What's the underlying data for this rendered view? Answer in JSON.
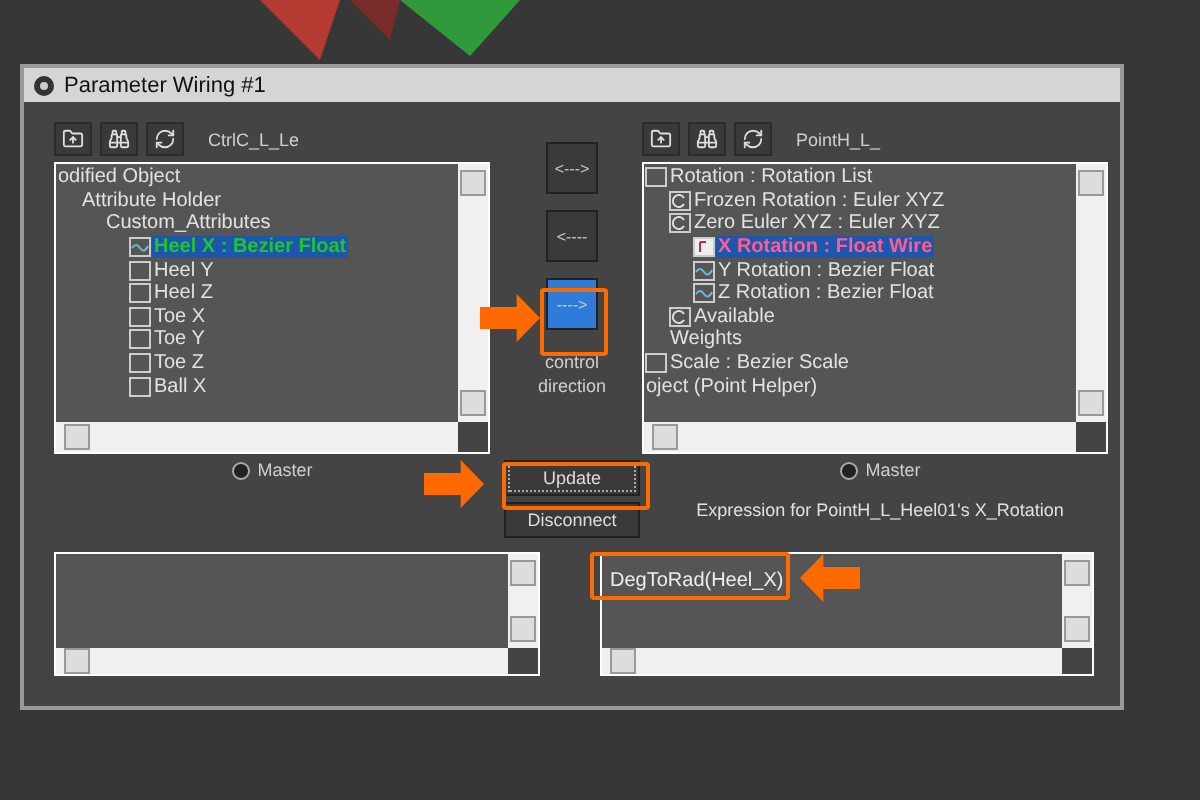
{
  "window": {
    "title": "Parameter Wiring #1"
  },
  "left_panel": {
    "object_name": "CtrlC_L_Le",
    "master": {
      "label": "Master",
      "selected": false
    },
    "tree": [
      {
        "label": "odified Object",
        "children": [
          {
            "label": "Attribute Holder",
            "children": [
              {
                "label": "Custom_Attributes",
                "children": [
                  {
                    "label": "Heel X : Bezier Float",
                    "kind": "curve",
                    "selected": true
                  },
                  {
                    "label": "Heel Y",
                    "kind": "box",
                    "selected": false
                  },
                  {
                    "label": "Heel Z",
                    "kind": "box",
                    "selected": false
                  },
                  {
                    "label": "Toe X",
                    "kind": "box",
                    "selected": false
                  },
                  {
                    "label": "Toe Y",
                    "kind": "box",
                    "selected": false
                  },
                  {
                    "label": "Toe Z",
                    "kind": "box",
                    "selected": false
                  },
                  {
                    "label": "Ball X",
                    "kind": "box",
                    "selected": false
                  }
                ]
              }
            ]
          }
        ]
      }
    ]
  },
  "right_panel": {
    "object_name": "PointH_L_",
    "master": {
      "label": "Master",
      "selected": false
    },
    "tree": [
      {
        "label": "Rotation : Rotation List",
        "kind": "box",
        "children": [
          {
            "label": "Frozen Rotation : Euler XYZ",
            "kind": "rotation"
          },
          {
            "label": "Zero Euler XYZ : Euler XYZ",
            "kind": "rotation",
            "children": [
              {
                "label": "X Rotation : Float Wire",
                "kind": "wire",
                "selected": true
              },
              {
                "label": "Y Rotation : Bezier Float",
                "kind": "curve",
                "selected": false
              },
              {
                "label": "Z Rotation : Bezier Float",
                "kind": "curve",
                "selected": false
              }
            ]
          },
          {
            "label": "Available",
            "kind": "rotation"
          },
          {
            "label": "Weights"
          }
        ]
      },
      {
        "label": "Scale : Bezier Scale",
        "kind": "box"
      },
      {
        "label": "oject (Point Helper)"
      }
    ]
  },
  "direction_buttons": [
    {
      "label": "<--->",
      "selected": false
    },
    {
      "label": "<----",
      "selected": false
    },
    {
      "label": "---->",
      "selected": true
    }
  ],
  "direction_caption": "control direction",
  "buttons": [
    {
      "label": "Update",
      "focused": true
    },
    {
      "label": "Disconnect",
      "focused": false
    }
  ],
  "expression_label": "Expression for PointH_L_Heel01's X_Rotation",
  "expression": {
    "value": "DegToRad(Heel_X)"
  }
}
